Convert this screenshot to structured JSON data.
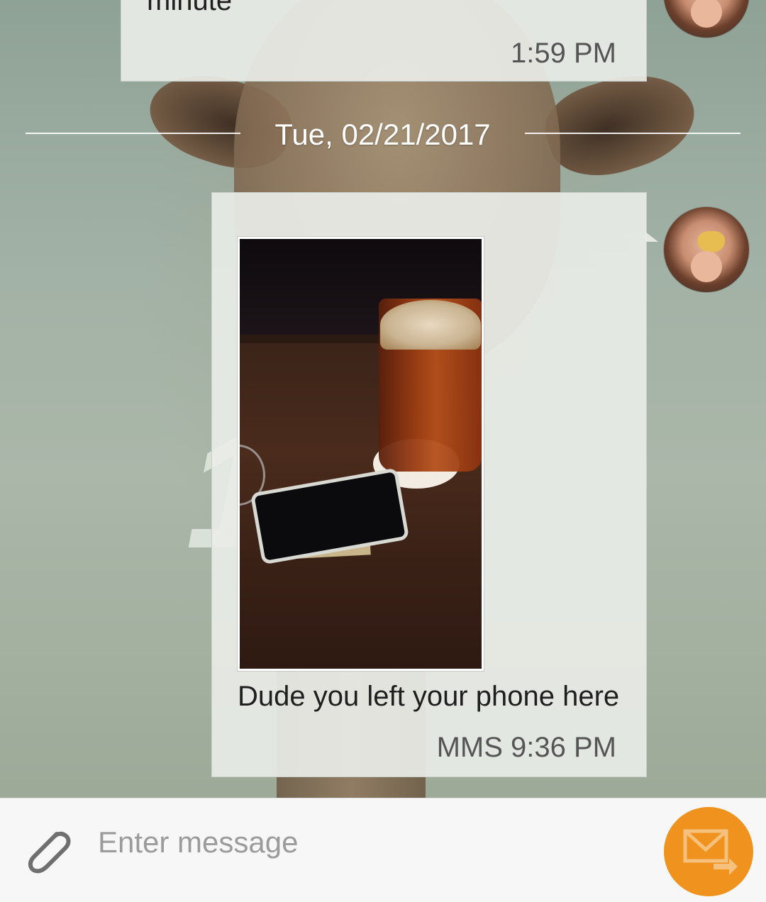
{
  "conversation": {
    "previous_message": {
      "text": "minute",
      "time": "1:59 PM"
    },
    "date_divider": "Tue, 02/21/2017",
    "messages": [
      {
        "caption": "Dude you left your phone here",
        "meta": "MMS 9:36 PM",
        "attachment": "photo"
      }
    ]
  },
  "wallpaper": {
    "overlay_text": "1"
  },
  "composer": {
    "placeholder": "Enter message",
    "attach_icon": "paperclip-icon",
    "send_icon": "envelope-send-icon"
  },
  "colors": {
    "send_button": "#f0921e",
    "bubble": "#e8ece6",
    "divider_text": "#ffffff"
  }
}
